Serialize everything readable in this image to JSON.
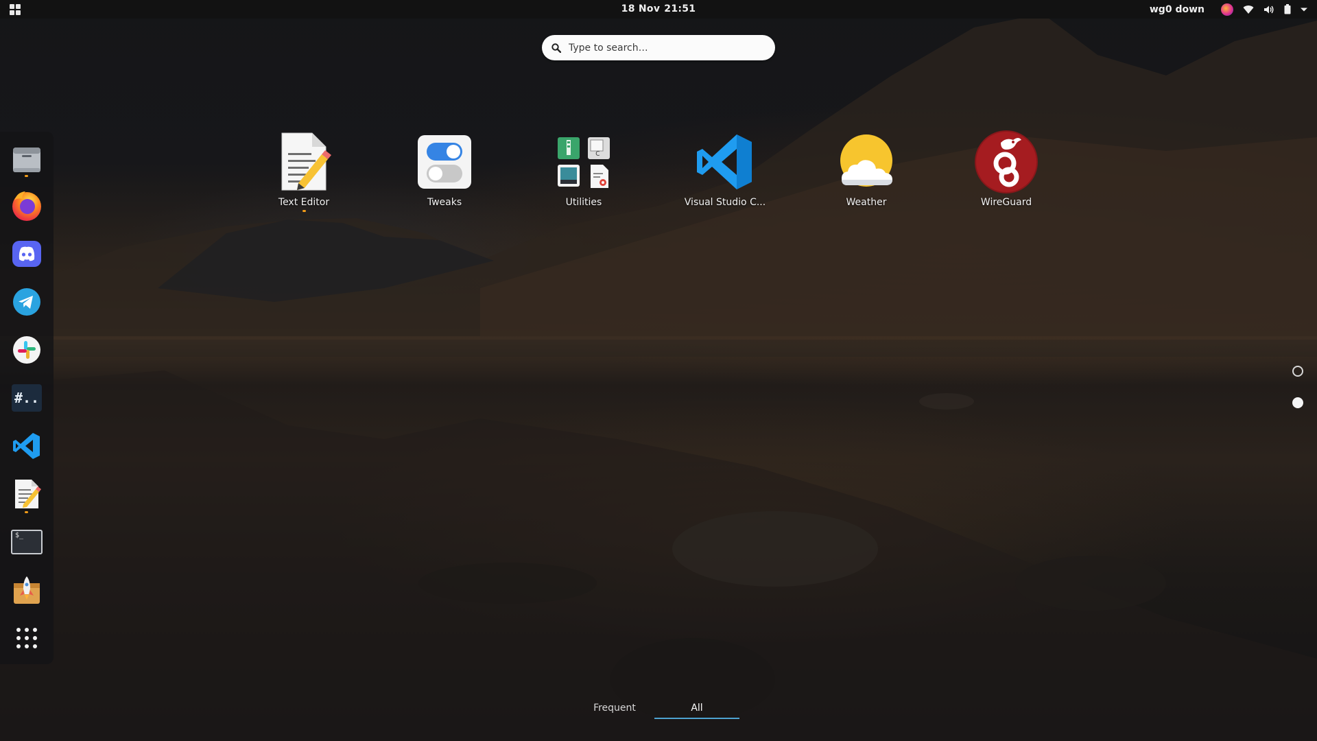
{
  "topbar": {
    "activities_icon": "app-grid-icon",
    "date": "18 Nov",
    "time": "21:51",
    "vpn_status": "wg0 down",
    "tray_icons": [
      "night-light-icon",
      "wifi-icon",
      "volume-icon",
      "battery-icon",
      "chevron-down-icon"
    ]
  },
  "search": {
    "placeholder": "Type to search…",
    "icon": "search-icon"
  },
  "dock": {
    "items": [
      {
        "name": "files",
        "icon": "files-icon",
        "running": true
      },
      {
        "name": "firefox",
        "icon": "firefox-icon",
        "running": false
      },
      {
        "name": "discord",
        "icon": "discord-icon",
        "running": false
      },
      {
        "name": "telegram",
        "icon": "telegram-icon",
        "running": false
      },
      {
        "name": "slack",
        "icon": "slack-icon",
        "running": false
      },
      {
        "name": "hashtag-app",
        "icon": "hashtag-icon",
        "running": false
      },
      {
        "name": "vscode",
        "icon": "vscode-icon",
        "running": false
      },
      {
        "name": "text-editor",
        "icon": "text-editor-icon",
        "running": true
      },
      {
        "name": "terminal",
        "icon": "terminal-icon",
        "running": false
      },
      {
        "name": "installer",
        "icon": "rocket-installer-icon",
        "running": false
      },
      {
        "name": "show-apps",
        "icon": "show-apps-grid-icon",
        "running": false
      }
    ],
    "terminal_prompt": "$_",
    "hashtag_text": "#.."
  },
  "apps": [
    {
      "label": "Text Editor",
      "icon": "text-editor-icon",
      "running": true
    },
    {
      "label": "Tweaks",
      "icon": "tweaks-icon",
      "running": false
    },
    {
      "label": "Utilities",
      "icon": "utilities-folder-icon",
      "running": false
    },
    {
      "label": "Visual Studio C...",
      "icon": "vscode-icon",
      "running": false
    },
    {
      "label": "Weather",
      "icon": "weather-icon",
      "running": false
    },
    {
      "label": "WireGuard",
      "icon": "wireguard-icon",
      "running": false
    }
  ],
  "pages": {
    "count": 2,
    "current": 2
  },
  "tabs": [
    {
      "label": "Frequent",
      "active": false
    },
    {
      "label": "All",
      "active": true
    }
  ],
  "colors": {
    "accent": "#4ea3d1",
    "running_indicator": "#f29c18",
    "topbar": "#121212"
  }
}
